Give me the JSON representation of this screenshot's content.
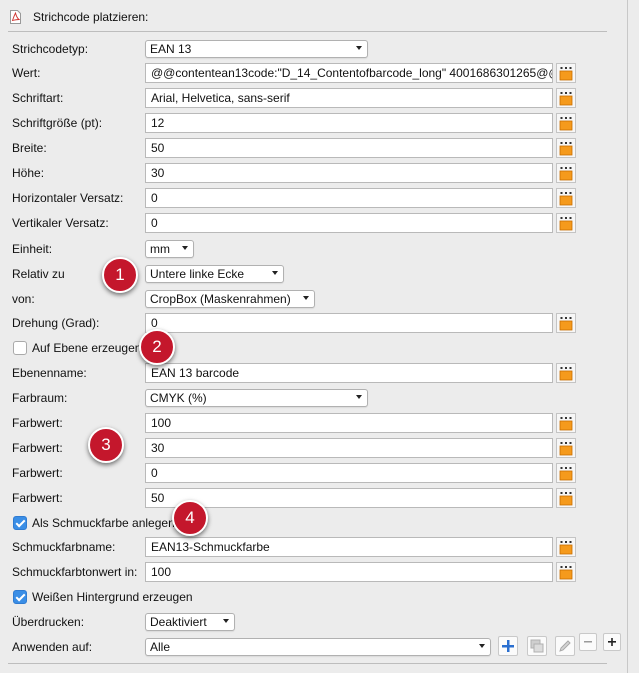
{
  "header": {
    "title": "Strichcode platzieren:"
  },
  "fields": {
    "barcode_type": {
      "label": "Strichcodetyp:",
      "value": "EAN 13"
    },
    "value": {
      "label": "Wert:",
      "value": "@@contentean13code:\"D_14_Contentofbarcode_long\" 4001686301265@@"
    },
    "font": {
      "label": "Schriftart:",
      "value": "Arial, Helvetica, sans-serif"
    },
    "font_size": {
      "label": "Schriftgröße (pt):",
      "value": "12"
    },
    "width": {
      "label": "Breite:",
      "value": "50"
    },
    "height": {
      "label": "Höhe:",
      "value": "30"
    },
    "h_offset": {
      "label": "Horizontaler Versatz:",
      "value": "0"
    },
    "v_offset": {
      "label": "Vertikaler Versatz:",
      "value": "0"
    },
    "unit": {
      "label": "Einheit:",
      "value": "mm"
    },
    "relative_to": {
      "label": "Relativ zu",
      "value": "Untere linke Ecke"
    },
    "of": {
      "label": "von:",
      "value": "CropBox (Maskenrahmen)"
    },
    "rotation": {
      "label": "Drehung (Grad):",
      "value": "0"
    },
    "create_on_layer": {
      "label": "Auf Ebene erzeugen",
      "checked": false
    },
    "layer_name": {
      "label": "Ebenenname:",
      "value": "EAN 13 barcode"
    },
    "color_space": {
      "label": "Farbraum:",
      "value": "CMYK (%)"
    },
    "color_values": [
      {
        "label": "Farbwert:",
        "value": "100"
      },
      {
        "label": "Farbwert:",
        "value": "30"
      },
      {
        "label": "Farbwert:",
        "value": "0"
      },
      {
        "label": "Farbwert:",
        "value": "50"
      }
    ],
    "spot_color": {
      "label": "Als Schmuckfarbe anlegen",
      "checked": true
    },
    "spot_name": {
      "label": "Schmuckfarbname:",
      "value": "EAN13-Schmuckfarbe"
    },
    "spot_tint": {
      "label": "Schmuckfarbtonwert in:",
      "value": "100"
    },
    "white_bg": {
      "label": "Weißen Hintergrund erzeugen",
      "checked": true
    },
    "overprint": {
      "label": "Überdrucken:",
      "value": "Deaktiviert"
    },
    "apply_to": {
      "label": "Anwenden auf:",
      "value": "Alle"
    }
  },
  "annotations": [
    "1",
    "2",
    "3",
    "4"
  ],
  "icons": {
    "picker": "variable-picker-icon",
    "add": "plus-blue-icon",
    "duplicate": "duplicate-icon",
    "edit": "pencil-icon",
    "remove": "minus-icon",
    "add_row": "plus-icon"
  },
  "colors": {
    "badge": "#c4172c",
    "picker_orange": "#f59a1c",
    "checkbox_blue": "#3a8ee6"
  }
}
